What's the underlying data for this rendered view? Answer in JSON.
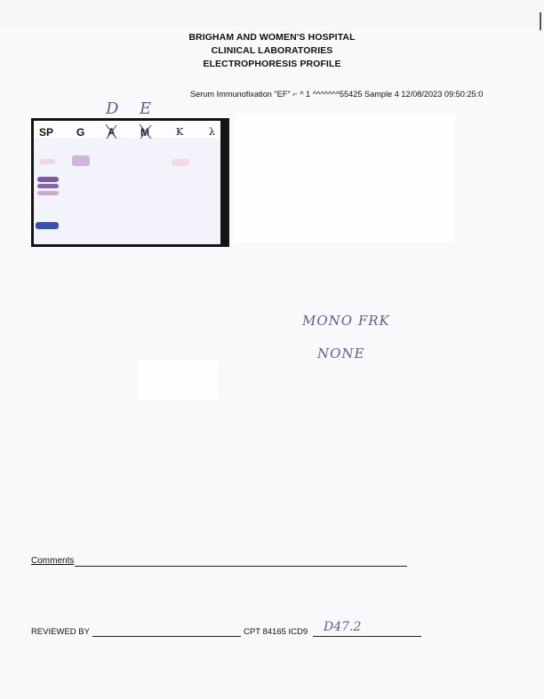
{
  "header": {
    "hospital": "BRIGHAM AND WOMEN'S HOSPITAL",
    "department": "CLINICAL LABORATORIES",
    "report_type": "ELECTROPHORESIS PROFILE"
  },
  "test_line": "Serum Immunofixation \"EF\" ⌐ ^ 1 ^^^^^^^55425  Sample 4  12/08/2023  09:50:25:0",
  "gel": {
    "lanes": [
      "SP",
      "G",
      "A",
      "M",
      "K",
      "λ"
    ],
    "handwritten_over_lanes": [
      "D",
      "E"
    ]
  },
  "handwritten_note": {
    "line1": "MONO FRK",
    "line2": "NONE"
  },
  "comments": {
    "label": "Comments"
  },
  "footer": {
    "reviewed_by_label": "REVIEWED BY",
    "cpt_label": "CPT 84165 ICD9",
    "icd9_handwritten": "D47.2"
  },
  "colors": {
    "ink": "#5b5f99",
    "band_blue": "#3a4fb0",
    "band_violet": "#7b5aa8"
  }
}
